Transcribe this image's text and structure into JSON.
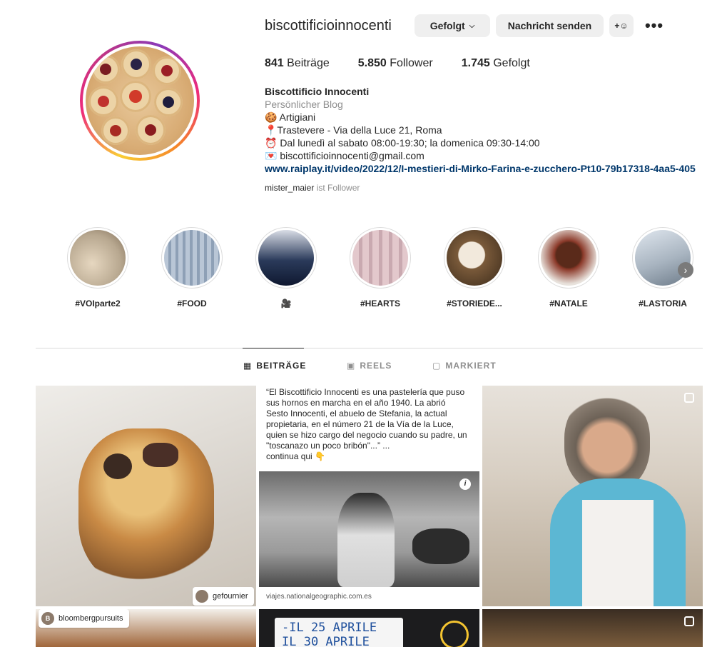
{
  "profile": {
    "username": "biscottificioinnocenti",
    "buttons": {
      "follow": "Gefolgt",
      "message": "Nachricht senden",
      "add_user": "+☺",
      "more": "•••"
    },
    "stats": [
      {
        "value": "841",
        "label": "Beiträge"
      },
      {
        "value": "5.850",
        "label": "Follower"
      },
      {
        "value": "1.745",
        "label": "Gefolgt"
      }
    ],
    "bio": {
      "name": "Biscottificio Innocenti",
      "category": "Persönlicher Blog",
      "lines": [
        "🍪 Artigiani",
        "📍Trastevere - Via della Luce 21, Roma",
        "⏰ Dal lunedì al sabato 08:00-19:30; la domenica 09:30-14:00",
        "💌 biscottificioinnocenti@gmail.com"
      ],
      "link": "www.raiplay.it/video/2022/12/I-mestieri-di-Mirko-Farina-e-zucchero-Pt10-79b17318-4aa5-405"
    },
    "followed_by": {
      "user": "mister_maier",
      "suffix": "ist Follower"
    }
  },
  "highlights": [
    {
      "label": "#VOIparte2",
      "color": "#b8a890"
    },
    {
      "label": "#FOOD",
      "color": "#8ea0b6"
    },
    {
      "label": "🎥",
      "color": "#2a3a5a"
    },
    {
      "label": "#HEARTS",
      "color": "#c9a9b0"
    },
    {
      "label": "#STORIEDE...",
      "color": "#7a5a3a"
    },
    {
      "label": "#NATALE",
      "color": "#8c3a2a"
    },
    {
      "label": "#LASTORIA",
      "color": "#a8b4c0"
    }
  ],
  "tabs": [
    {
      "label": "BEITRÄGE",
      "icon": "▦"
    },
    {
      "label": "REELS",
      "icon": "▣"
    },
    {
      "label": "MARKIERT",
      "icon": "▢"
    }
  ],
  "posts": {
    "p1": {
      "tag": "gefournier"
    },
    "p2": {
      "quote": "“El Biscottificio Innocenti es una pastelería que puso sus hornos en marcha en el año 1940. La abrió Sesto Innocenti, el abuelo de Stefania, la actual propietaria, en el número 21 de la Vía de la Luce, quien se hizo cargo del negocio cuando su padre, un \"toscanazo un poco bribón\"...” ...",
      "more": "continua qui 👇",
      "source": "viajes.nationalgeographic.com.es"
    },
    "p4": {
      "tag": "bloombergpursuits"
    },
    "p5": {
      "sign_1": "-IL 25 APRILE",
      "sign_2": "IL 30 APRILE"
    }
  }
}
